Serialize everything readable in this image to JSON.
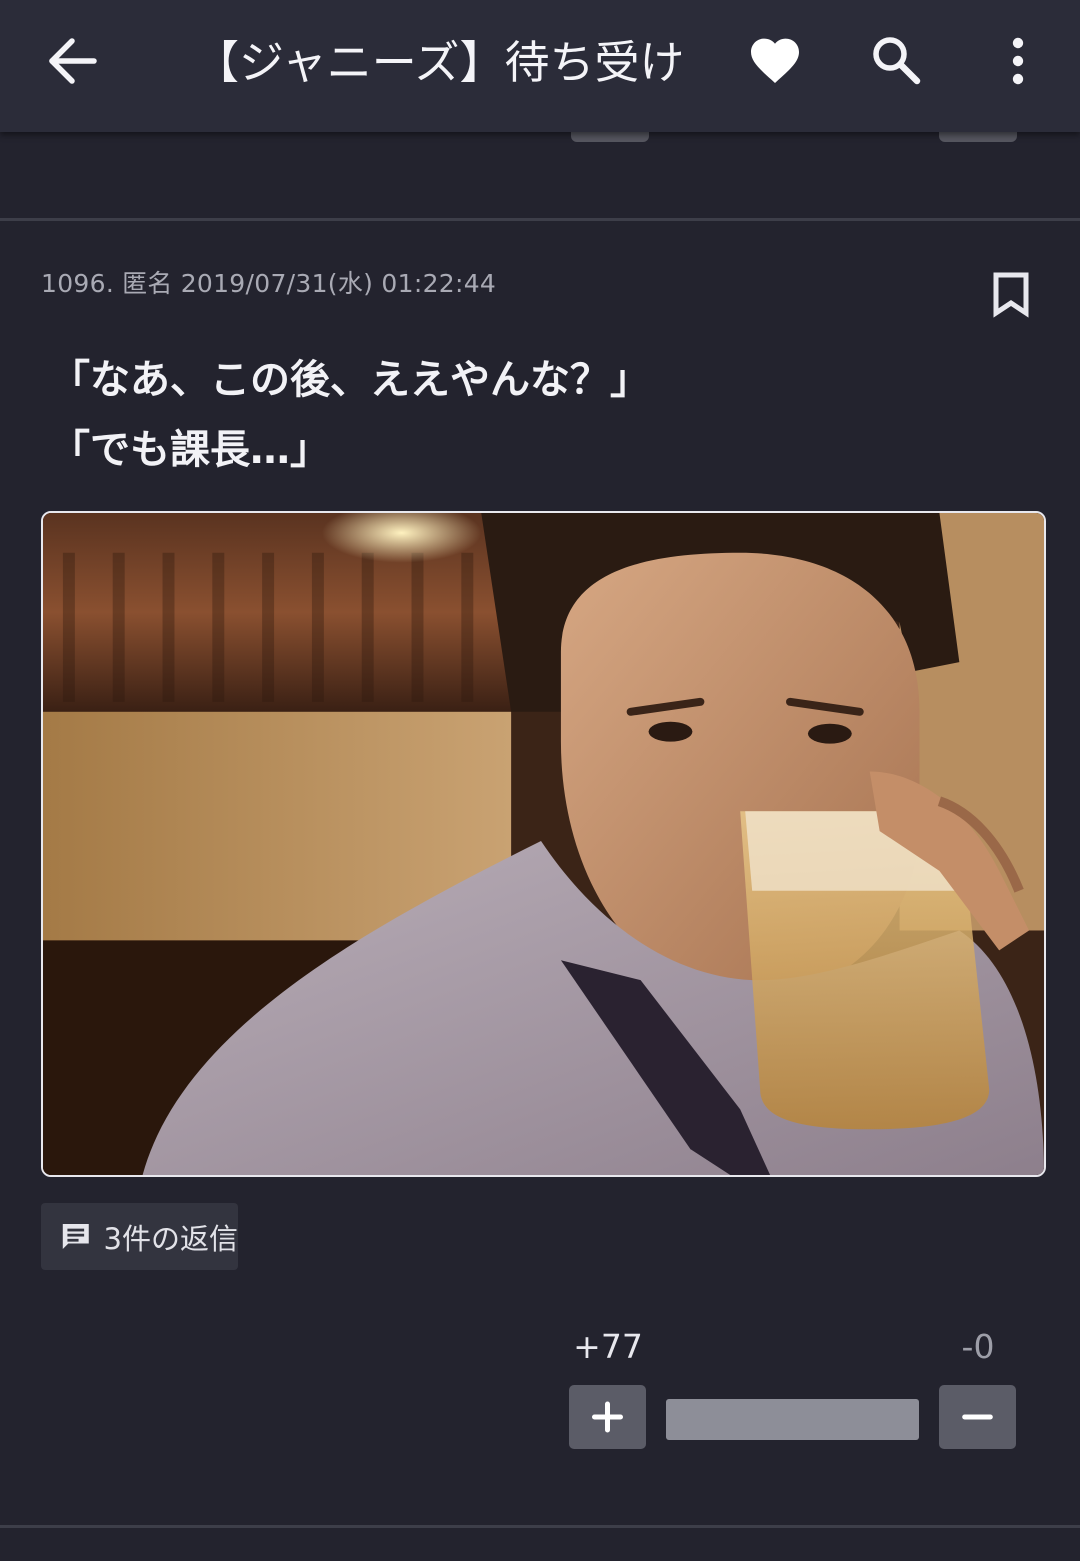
{
  "app_bar": {
    "title": "【ジャニーズ】待ち受け…",
    "back_icon": "arrow-back-icon",
    "favorite_icon": "heart-icon",
    "search_icon": "search-icon",
    "menu_icon": "more-vertical-icon"
  },
  "post": {
    "number": "1096.",
    "author": "匿名",
    "datetime": "2019/07/31(水) 01:22:44",
    "bookmark_icon": "bookmark-outline-icon",
    "text_lines": [
      "「なあ、この後、ええやんな？」",
      "「でも課長…」"
    ],
    "image_icon": "photo-man-drinking-beer",
    "replies_label": "3件の返信",
    "replies_icon": "comment-icon",
    "votes": {
      "plus_label": "+77",
      "minus_label": "-0",
      "plus": 77,
      "minus": 0,
      "plus_ratio": 1.0
    }
  },
  "colors": {
    "background": "#23232e",
    "app_bar": "#2b2c39",
    "button": "#5b5c67",
    "accent_text": "#f2f2f6"
  }
}
